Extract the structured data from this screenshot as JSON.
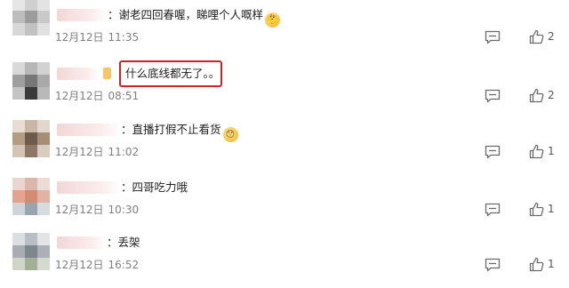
{
  "comments": [
    {
      "text": "：谢老四回春喔，睇哩个人嘅样",
      "emoji": "🤔",
      "emoji_name": "thinking-emoji",
      "date": "12月12日",
      "time": "11:35",
      "likes": "2",
      "highlighted": false,
      "has_vip": false
    },
    {
      "text": "什么底线都无了。。",
      "emoji": "",
      "emoji_name": "",
      "date": "12月12日",
      "time": "08:51",
      "likes": "2",
      "highlighted": true,
      "has_vip": true
    },
    {
      "text": "：直播打假不止看货",
      "emoji": "😯",
      "emoji_name": "surprised-emoji",
      "date": "12月12日",
      "time": "11:02",
      "likes": "1",
      "highlighted": false,
      "has_vip": false
    },
    {
      "text": "：四哥吃力哦",
      "emoji": "",
      "emoji_name": "",
      "date": "12月12日",
      "time": "10:30",
      "likes": "1",
      "highlighted": false,
      "has_vip": false
    },
    {
      "text": "：丢架",
      "emoji": "",
      "emoji_name": "",
      "date": "12月12日",
      "time": "16:52",
      "likes": "1",
      "highlighted": false,
      "has_vip": false
    }
  ],
  "icons": {
    "reply": "reply-icon",
    "like": "thumbs-up-icon"
  },
  "colors": {
    "highlight_border": "#c8252a",
    "username_blur": "#f3d6d6",
    "timestamp": "#808080",
    "vip_badge": "#f7c36b"
  }
}
